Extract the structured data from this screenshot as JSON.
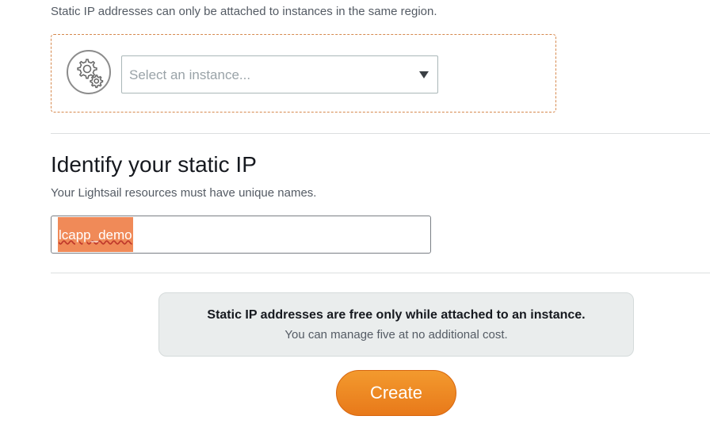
{
  "attach": {
    "note": "Static IP addresses can only be attached to instances in the same region.",
    "instance_select": {
      "placeholder": "Select an instance...",
      "icon": "gears-icon"
    }
  },
  "identify": {
    "title": "Identify your static IP",
    "hint": "Your Lightsail resources must have unique names.",
    "name_value": "lcapp_demo"
  },
  "info": {
    "title": "Static IP addresses are free only while attached to an instance.",
    "subtitle": "You can manage five at no additional cost."
  },
  "actions": {
    "create_label": "Create"
  },
  "colors": {
    "accent": "#ec7211",
    "dashed_border": "#d6894e",
    "selection_highlight": "#f08a58"
  }
}
